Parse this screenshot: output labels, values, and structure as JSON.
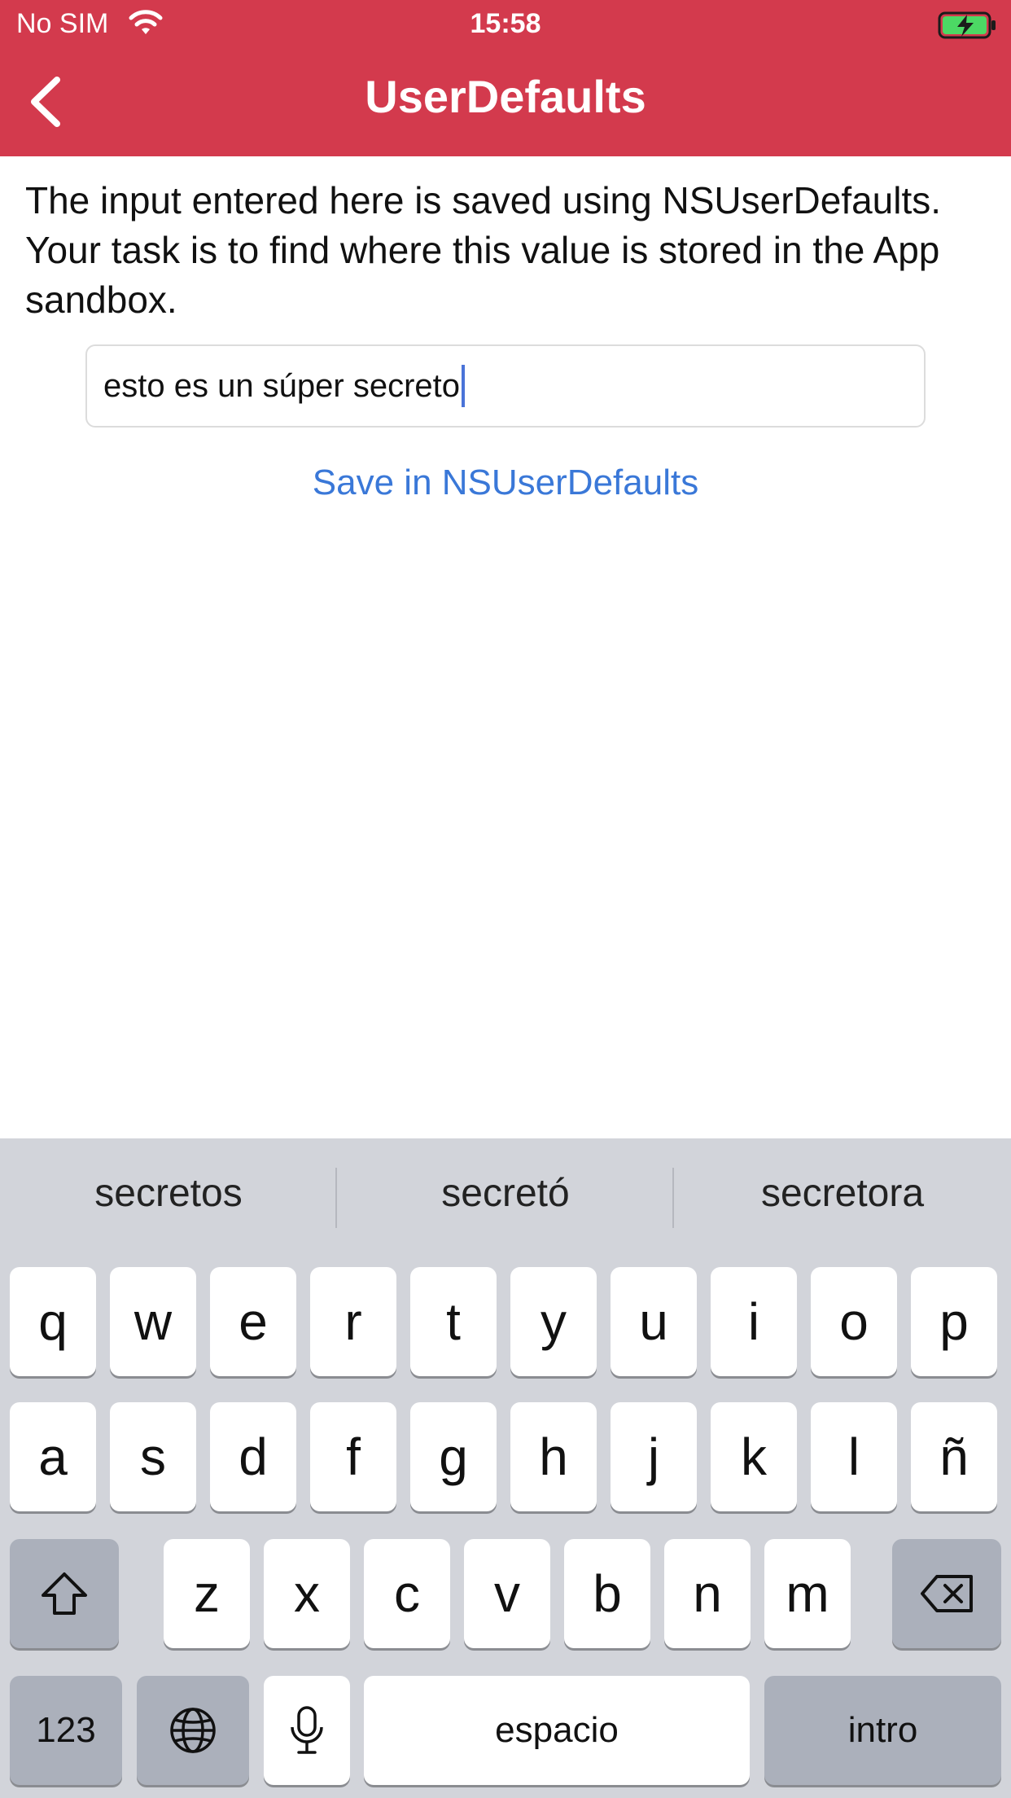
{
  "status_bar": {
    "carrier": "No SIM",
    "time": "15:58",
    "wifi_icon": "wifi-icon",
    "battery_icon": "battery-charging-icon"
  },
  "nav": {
    "title": "UserDefaults",
    "back_icon": "chevron-left-icon",
    "background_color": "#d33a4d"
  },
  "content": {
    "description": "The input entered here is saved using NSUserDefaults. Your task is to find where this value is stored in the App sandbox.",
    "input_value": "esto es un súper secreto",
    "save_label": "Save in NSUserDefaults",
    "link_color": "#3a78d8"
  },
  "keyboard": {
    "suggestions": [
      "secretos",
      "secretó",
      "secretora"
    ],
    "row1": [
      "q",
      "w",
      "e",
      "r",
      "t",
      "y",
      "u",
      "i",
      "o",
      "p"
    ],
    "row2": [
      "a",
      "s",
      "d",
      "f",
      "g",
      "h",
      "j",
      "k",
      "l",
      "ñ"
    ],
    "row3": [
      "z",
      "x",
      "c",
      "v",
      "b",
      "n",
      "m"
    ],
    "numbers_label": "123",
    "space_label": "espacio",
    "return_label": "intro",
    "shift_icon": "shift-icon",
    "delete_icon": "backspace-icon",
    "globe_icon": "globe-icon",
    "mic_icon": "microphone-icon"
  }
}
